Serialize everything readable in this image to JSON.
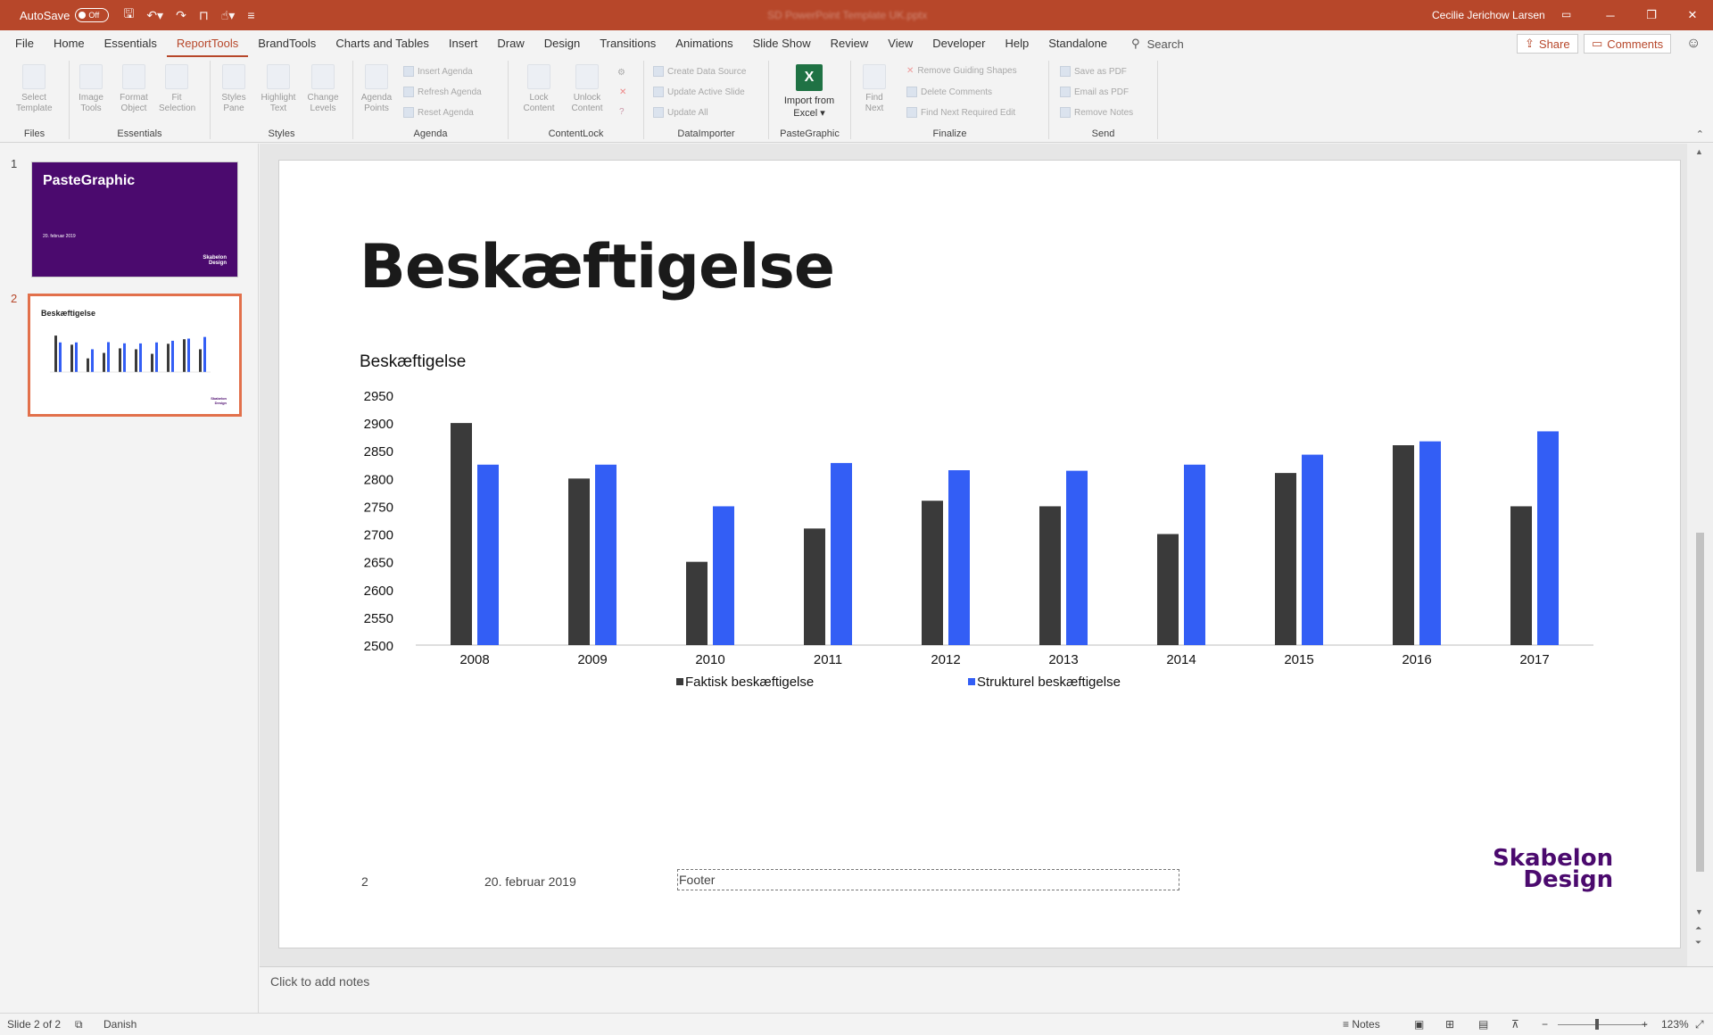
{
  "titlebar": {
    "autosave_label": "AutoSave",
    "autosave_state": "Off",
    "doc_title": "SD PowerPoint Template UK.pptx",
    "user": "Cecilie Jerichow Larsen"
  },
  "tabs": [
    "File",
    "Home",
    "Essentials",
    "ReportTools",
    "BrandTools",
    "Charts and Tables",
    "Insert",
    "Draw",
    "Design",
    "Transitions",
    "Animations",
    "Slide Show",
    "Review",
    "View",
    "Developer",
    "Help",
    "Standalone"
  ],
  "active_tab": "ReportTools",
  "search_label": "Search",
  "share_label": "Share",
  "comments_label": "Comments",
  "ribbon": {
    "groups": {
      "files": "Files",
      "essentials": "Essentials",
      "styles": "Styles",
      "agenda": "Agenda",
      "contentlock": "ContentLock",
      "dataimporter": "DataImporter",
      "pastegraphic": "PasteGraphic",
      "finalize": "Finalize",
      "send": "Send"
    },
    "buttons": {
      "select_template": "Select Template",
      "image_tools": "Image Tools",
      "format_object": "Format Object",
      "fit_selection": "Fit Selection",
      "styles_pane": "Styles Pane",
      "highlight_text": "Highlight Text",
      "change_levels": "Change Levels",
      "agenda_points": "Agenda Points",
      "insert_agenda": "Insert Agenda",
      "refresh_agenda": "Refresh Agenda",
      "reset_agenda": "Reset Agenda",
      "lock_content": "Lock Content",
      "unlock_content": "Unlock Content",
      "create_data_source": "Create Data Source",
      "update_active_slide": "Update Active Slide",
      "update_all": "Update All",
      "import_from_excel_1": "Import from",
      "import_from_excel_2": "Excel",
      "find_next": "Find Next",
      "remove_guiding_shapes": "Remove Guiding Shapes",
      "delete_comments": "Delete Comments",
      "find_next_required_edit": "Find Next Required Edit",
      "save_as_pdf": "Save as PDF",
      "email_as_pdf": "Email as PDF",
      "remove_notes": "Remove Notes"
    }
  },
  "slides_pane": {
    "slide1": {
      "number": "1",
      "title": "PasteGraphic",
      "date": "20. februar 2019",
      "logo_line1": "Skabelon",
      "logo_line2": "Design"
    },
    "slide2": {
      "number": "2",
      "title": "Beskæftigelse",
      "logo_line1": "Skabelon",
      "logo_line2": "Design"
    }
  },
  "slide": {
    "title": "Beskæftigelse",
    "footer_number": "2",
    "footer_date": "20. februar 2019",
    "footer_text": "Footer",
    "logo_line1": "Skabelon",
    "logo_line2": "Design"
  },
  "chart_data": {
    "type": "bar",
    "title": "Beskæftigelse",
    "categories": [
      "2008",
      "2009",
      "2010",
      "2011",
      "2012",
      "2013",
      "2014",
      "2015",
      "2016",
      "2017"
    ],
    "series": [
      {
        "name": "Faktisk beskæftigelse",
        "values": [
          2900,
          2800,
          2650,
          2710,
          2760,
          2750,
          2700,
          2810,
          2860,
          2750
        ],
        "color": "#3a3a3a"
      },
      {
        "name": "Strukturel beskæftigelse",
        "values": [
          2825,
          2825,
          2750,
          2828,
          2815,
          2814,
          2825,
          2843,
          2867,
          2885
        ],
        "color": "#335ef5"
      }
    ],
    "ylim": [
      2500,
      2950
    ],
    "yticks": [
      2500,
      2550,
      2600,
      2650,
      2700,
      2750,
      2800,
      2850,
      2900,
      2950
    ],
    "legend": "bottom",
    "grid": false
  },
  "notes_placeholder": "Click to add notes",
  "status": {
    "slide_info": "Slide 2 of 2",
    "language": "Danish",
    "notes_label": "Notes",
    "zoom": "123%"
  }
}
